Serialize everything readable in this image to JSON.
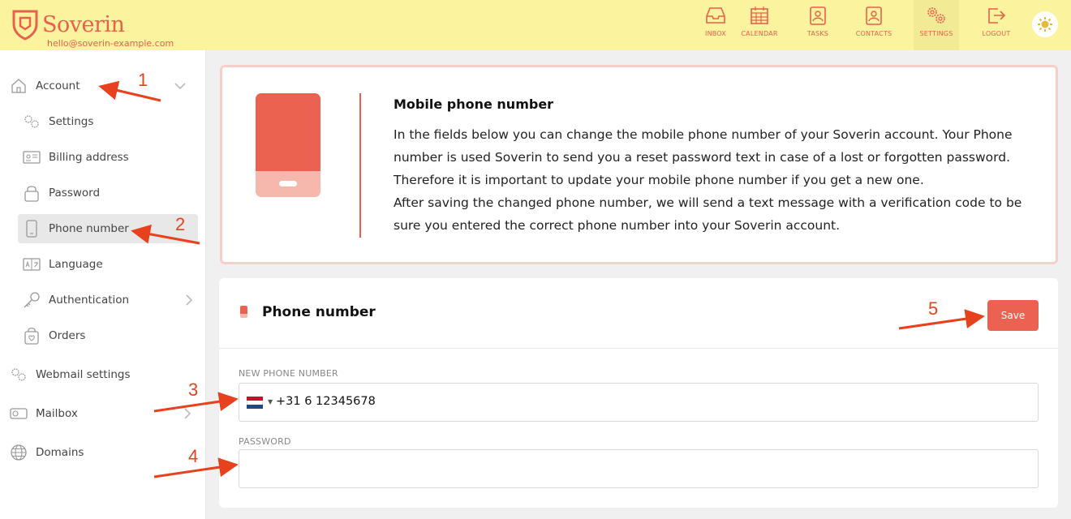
{
  "app": {
    "brand": "Soverin",
    "email": "hello@soverin-example.com",
    "accent": "#e8604e",
    "header_bg": "#fbf39e"
  },
  "nav": [
    {
      "label": "INBOX",
      "icon": "inbox-icon"
    },
    {
      "label": "CALENDAR",
      "icon": "calendar-icon"
    },
    {
      "label": "TASKS",
      "icon": "tasks-icon"
    },
    {
      "label": "CONTACTS",
      "icon": "contacts-icon"
    },
    {
      "label": "SETTINGS",
      "icon": "settings-icon",
      "active": true
    },
    {
      "label": "LOGOUT",
      "icon": "logout-icon"
    }
  ],
  "sidebar": {
    "account": "Account",
    "items": [
      {
        "label": "Settings",
        "icon": "gears-icon"
      },
      {
        "label": "Billing address",
        "icon": "id-card-icon"
      },
      {
        "label": "Password",
        "icon": "lock-icon"
      },
      {
        "label": "Phone number",
        "icon": "phone-icon",
        "active": true
      },
      {
        "label": "Language",
        "icon": "language-icon"
      },
      {
        "label": "Authentication",
        "icon": "key-icon"
      },
      {
        "label": "Orders",
        "icon": "bag-icon"
      }
    ],
    "webmail": "Webmail settings",
    "mailbox": "Mailbox",
    "domains": "Domains"
  },
  "info": {
    "title": "Mobile phone number",
    "text": "In the fields below you can change the mobile phone number of your Soverin account. Your Phone number is used Soverin to send you a reset password text in case of a lost or forgotten password. Therefore it is important to update your mobile phone number if you get a new one.",
    "text2": "After saving the changed phone number, we will send a text message with a verification code to be sure you entered the correct phone number into your Soverin account."
  },
  "form": {
    "title": "Phone number",
    "save_label": "Save",
    "phone_label": "NEW PHONE NUMBER",
    "phone_value": "+31 6 12345678",
    "country": "Netherlands",
    "password_label": "PASSWORD",
    "password_value": ""
  },
  "annotations": [
    "1",
    "2",
    "3",
    "4",
    "5"
  ]
}
